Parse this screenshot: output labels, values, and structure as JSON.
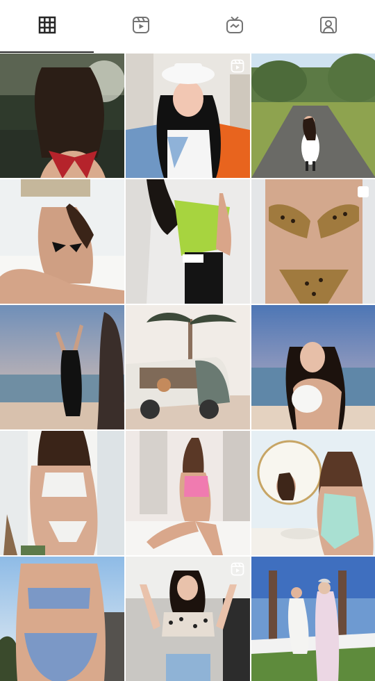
{
  "tabs": [
    {
      "name": "grid",
      "icon": "grid-icon",
      "active": true
    },
    {
      "name": "reels",
      "icon": "reels-icon",
      "active": false
    },
    {
      "name": "guides",
      "icon": "igtv-icon",
      "active": false
    },
    {
      "name": "tagged",
      "icon": "tagged-user-icon",
      "active": false
    }
  ],
  "posts": [
    {
      "id": 1,
      "theme": "dark-forest-beach",
      "badge": null
    },
    {
      "id": 2,
      "theme": "white-hat-studio",
      "badge": "reels-icon"
    },
    {
      "id": 3,
      "theme": "country-road",
      "badge": null
    },
    {
      "id": 4,
      "theme": "bathroom-bikini",
      "badge": null
    },
    {
      "id": 5,
      "theme": "green-top-studio",
      "badge": null
    },
    {
      "id": 6,
      "theme": "leopard-bikini",
      "badge": "carousel-icon"
    },
    {
      "id": 7,
      "theme": "sunset-beach-rocks",
      "badge": null
    },
    {
      "id": 8,
      "theme": "palm-van",
      "badge": null
    },
    {
      "id": 9,
      "theme": "beach-hat",
      "badge": null
    },
    {
      "id": 10,
      "theme": "white-swimsuit-house",
      "badge": null
    },
    {
      "id": 11,
      "theme": "pink-swimsuit-room",
      "badge": null
    },
    {
      "id": 12,
      "theme": "mint-swimsuit-mirror",
      "badge": null
    },
    {
      "id": 13,
      "theme": "blue-bikini-sky",
      "badge": null
    },
    {
      "id": 14,
      "theme": "leopard-top-dance",
      "badge": "reels-icon"
    },
    {
      "id": 15,
      "theme": "garden-couple",
      "badge": null
    }
  ],
  "colors": {
    "icon_dark": "#262626",
    "icon_muted": "#737373",
    "background": "#ffffff"
  }
}
